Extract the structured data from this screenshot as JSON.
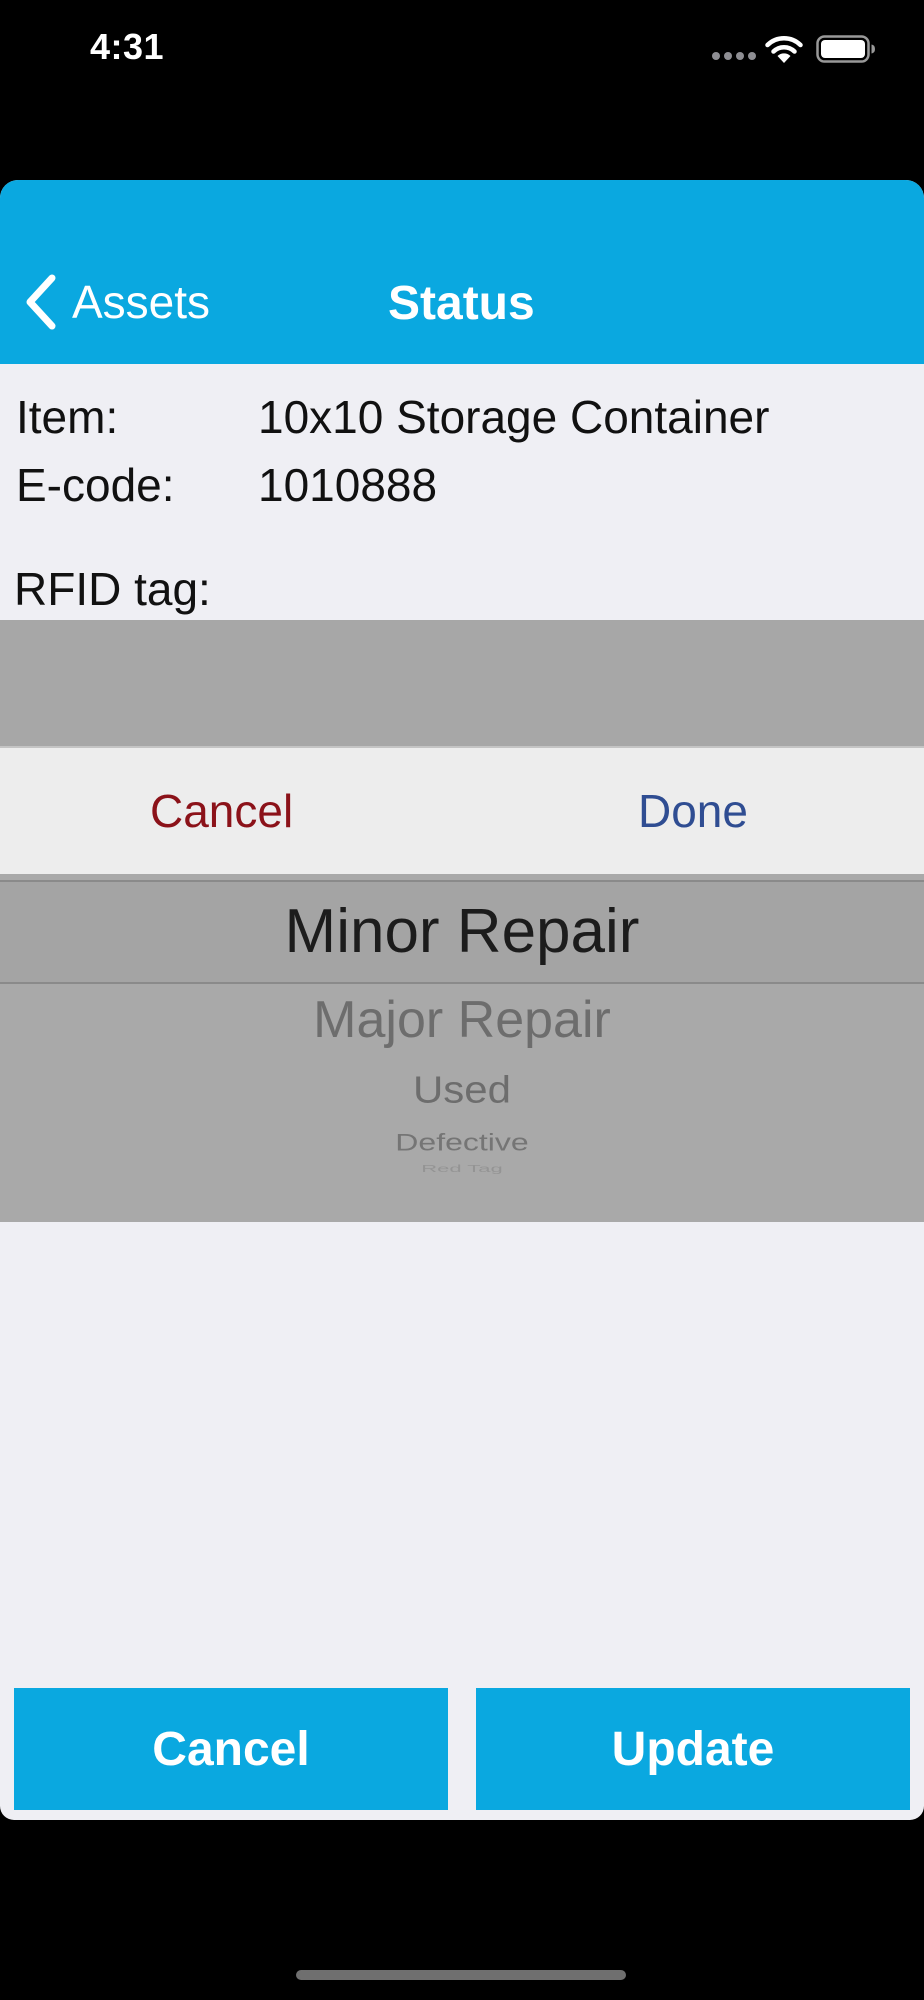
{
  "status_bar": {
    "time": "4:31"
  },
  "nav": {
    "back_label": "Assets",
    "title": "Status"
  },
  "details": {
    "item_label": "Item:",
    "item_value": "10x10 Storage Container",
    "ecode_label": "E-code:",
    "ecode_value": "1010888",
    "rfid_label": "RFID tag:"
  },
  "picker": {
    "cancel_label": "Cancel",
    "done_label": "Done",
    "options": [
      "Minor Repair",
      "Major Repair",
      "Used",
      "Defective",
      "Red Tag"
    ],
    "selected": "Minor Repair"
  },
  "actions": {
    "cancel_label": "Cancel",
    "update_label": "Update"
  },
  "colors": {
    "accent": "#0aa8e0",
    "cancel_text": "#8b1219",
    "done_text": "#2f4d92",
    "background": "#efeff4"
  },
  "icons": {
    "back": "chevron-left-icon",
    "signal": "cellular-signal-icon",
    "wifi": "wifi-icon",
    "battery": "battery-icon"
  }
}
